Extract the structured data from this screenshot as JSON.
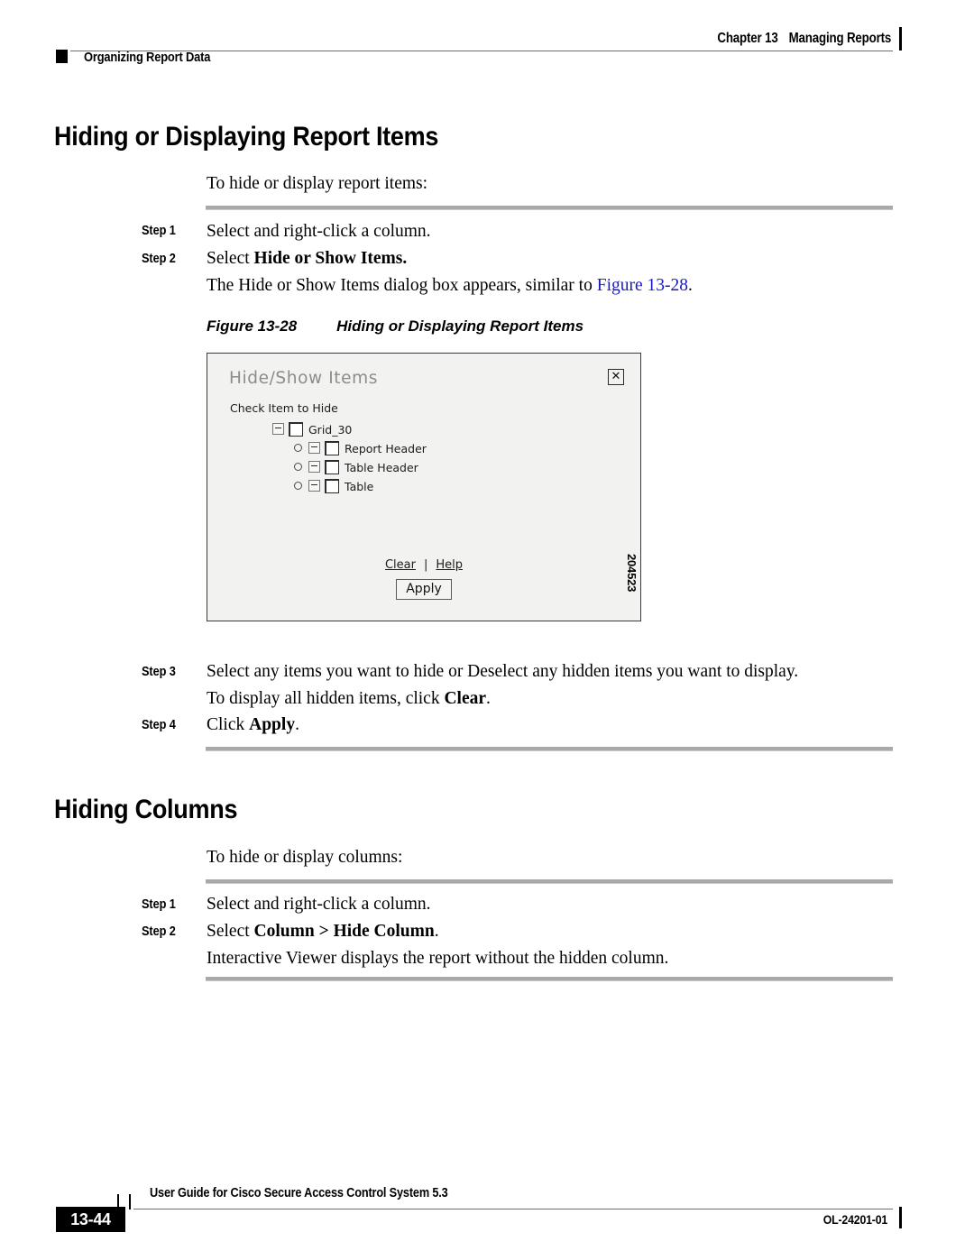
{
  "header": {
    "chapter_label": "Chapter 13",
    "chapter_title": "Managing Reports",
    "section_label": "Organizing Report Data"
  },
  "sections": [
    {
      "heading": "Hiding or Displaying Report Items",
      "intro": "To hide or display report items:",
      "steps": [
        {
          "label": "Step 1",
          "text_pre": "Select and right-click a column.",
          "text_bold": "",
          "text_post": ""
        },
        {
          "label": "Step 2",
          "text_pre": "Select ",
          "text_bold": "Hide or Show Items.",
          "text_post": ""
        }
      ],
      "after_step2_pre": "The Hide or Show Items dialog box appears, similar to ",
      "after_step2_link": "Figure 13-28",
      "after_step2_post": "."
    },
    {
      "heading": "Hiding Columns",
      "intro": "To hide or display columns:",
      "steps": [
        {
          "label": "Step 1",
          "text_pre": "Select and right-click a column.",
          "text_bold": "",
          "text_post": ""
        },
        {
          "label": "Step 2",
          "text_pre": "Select ",
          "text_bold": "Column > Hide Column",
          "text_post": "."
        }
      ],
      "closing": "Interactive Viewer displays the report without the hidden column."
    }
  ],
  "figure": {
    "caption_number": "Figure 13-28",
    "caption_title": "Hiding or Displaying Report Items",
    "art_id": "204523",
    "dialog": {
      "title": "Hide/Show Items",
      "close_icon": "close-x-icon",
      "subtitle": "Check Item to Hide",
      "tree": [
        {
          "level": 0,
          "label": "Grid_30",
          "has_bullet": false,
          "expander": "minus",
          "checked": false
        },
        {
          "level": 1,
          "label": "Report Header",
          "has_bullet": true,
          "expander": "minus",
          "checked": false
        },
        {
          "level": 1,
          "label": "Table Header",
          "has_bullet": true,
          "expander": "minus",
          "checked": false
        },
        {
          "level": 1,
          "label": "Table",
          "has_bullet": true,
          "expander": "minus",
          "checked": false
        }
      ],
      "clear_link": "Clear",
      "link_separator": "|",
      "help_link": "Help",
      "apply_button": "Apply"
    }
  },
  "steps_tail": {
    "step3_label": "Step 3",
    "step3_text": "Select any items you want to hide or Deselect any hidden items you want to display.",
    "step3_note_pre": "To display all hidden items, click ",
    "step3_note_bold": "Clear",
    "step3_note_post": ".",
    "step4_label": "Step 4",
    "step4_pre": "Click ",
    "step4_bold": "Apply",
    "step4_post": "."
  },
  "footer": {
    "page_number": "13-44",
    "guide_title": "User Guide for Cisco Secure Access Control System 5.3",
    "doc_id": "OL-24201-01"
  },
  "colors": {
    "link": "#1818c8",
    "rule": "#a9a9a9",
    "dialog_bg": "#f2f2f0",
    "dialog_title": "#8c8c8c"
  }
}
